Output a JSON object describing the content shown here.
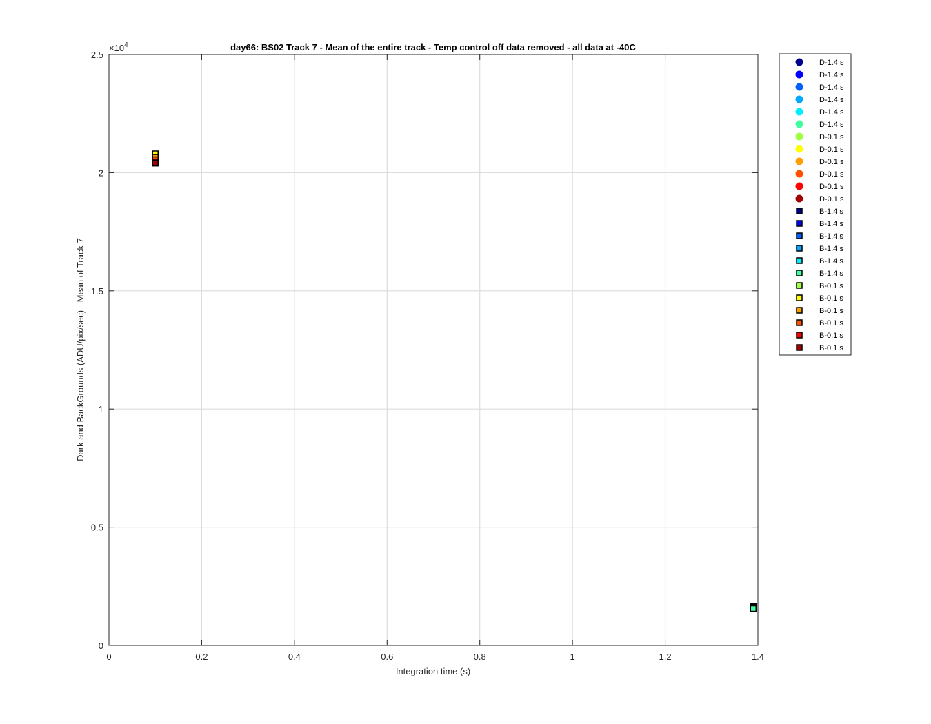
{
  "chart_data": {
    "type": "scatter",
    "title": "day66: BS02  Track 7 - Mean of the entire track - Temp control off data removed - all data at -40C",
    "xlabel": "Integration time (s)",
    "ylabel": "Dark and BackGrounds (ADU/pix/sec) - Mean of Track 7",
    "xlim": [
      0,
      1.4
    ],
    "ylim": [
      0,
      25000
    ],
    "x_ticks": [
      0,
      0.2,
      0.4,
      0.6,
      0.8,
      1.0,
      1.2,
      1.4
    ],
    "x_tick_labels": [
      "0",
      "0.2",
      "0.4",
      "0.6",
      "0.8",
      "1",
      "1.2",
      "1.4"
    ],
    "y_ticks": [
      0,
      5000,
      10000,
      15000,
      20000,
      25000
    ],
    "y_tick_labels": [
      "0",
      "0.5",
      "1",
      "1.5",
      "2",
      "2.5"
    ],
    "y_exponent_base": "×10",
    "y_exponent_power": "4",
    "grid": true,
    "legend_position": "outside-top-right",
    "series": [
      {
        "name": "D-1.4 s",
        "marker": "circle",
        "color": "#00008f",
        "x": [],
        "y": []
      },
      {
        "name": "D-1.4 s",
        "marker": "circle",
        "color": "#0000ff",
        "x": [],
        "y": []
      },
      {
        "name": "D-1.4 s",
        "marker": "circle",
        "color": "#0060ff",
        "x": [],
        "y": []
      },
      {
        "name": "D-1.4 s",
        "marker": "circle",
        "color": "#00a8ff",
        "x": [],
        "y": []
      },
      {
        "name": "D-1.4 s",
        "marker": "circle",
        "color": "#00efff",
        "x": [],
        "y": []
      },
      {
        "name": "D-1.4 s",
        "marker": "circle",
        "color": "#40ffa0",
        "x": [],
        "y": []
      },
      {
        "name": "D-0.1 s",
        "marker": "circle",
        "color": "#9fff40",
        "x": [],
        "y": []
      },
      {
        "name": "D-0.1 s",
        "marker": "circle",
        "color": "#ffff00",
        "x": [],
        "y": []
      },
      {
        "name": "D-0.1 s",
        "marker": "circle",
        "color": "#ffa000",
        "x": [],
        "y": []
      },
      {
        "name": "D-0.1 s",
        "marker": "circle",
        "color": "#ff5000",
        "x": [],
        "y": []
      },
      {
        "name": "D-0.1 s",
        "marker": "circle",
        "color": "#ff0000",
        "x": [],
        "y": []
      },
      {
        "name": "D-0.1 s",
        "marker": "circle",
        "color": "#a00000",
        "x": [],
        "y": []
      },
      {
        "name": "B-1.4 s",
        "marker": "square",
        "color": "#00008f",
        "x": [
          1.39
        ],
        "y": [
          1650
        ]
      },
      {
        "name": "B-1.4 s",
        "marker": "square",
        "color": "#0000ff",
        "x": [
          1.39
        ],
        "y": [
          1640
        ]
      },
      {
        "name": "B-1.4 s",
        "marker": "square",
        "color": "#0060ff",
        "x": [
          1.39
        ],
        "y": [
          1620
        ]
      },
      {
        "name": "B-1.4 s",
        "marker": "square",
        "color": "#00a8ff",
        "x": [
          1.39
        ],
        "y": [
          1600
        ]
      },
      {
        "name": "B-1.4 s",
        "marker": "square",
        "color": "#00efff",
        "x": [
          1.39
        ],
        "y": [
          1580
        ]
      },
      {
        "name": "B-1.4 s",
        "marker": "square",
        "color": "#40ffa0",
        "x": [
          1.39
        ],
        "y": [
          1560
        ]
      },
      {
        "name": "B-0.1 s",
        "marker": "square",
        "color": "#9fff40",
        "x": [
          0.1
        ],
        "y": [
          20750
        ]
      },
      {
        "name": "B-0.1 s",
        "marker": "square",
        "color": "#ffff00",
        "x": [
          0.1
        ],
        "y": [
          20800
        ]
      },
      {
        "name": "B-0.1 s",
        "marker": "square",
        "color": "#ffa000",
        "x": [
          0.1
        ],
        "y": [
          20650
        ]
      },
      {
        "name": "B-0.1 s",
        "marker": "square",
        "color": "#ff5000",
        "x": [
          0.1
        ],
        "y": [
          20550
        ]
      },
      {
        "name": "B-0.1 s",
        "marker": "square",
        "color": "#ff0000",
        "x": [
          0.1
        ],
        "y": [
          20450
        ]
      },
      {
        "name": "B-0.1 s",
        "marker": "square",
        "color": "#a00000",
        "x": [
          0.1
        ],
        "y": [
          20400
        ]
      }
    ]
  }
}
